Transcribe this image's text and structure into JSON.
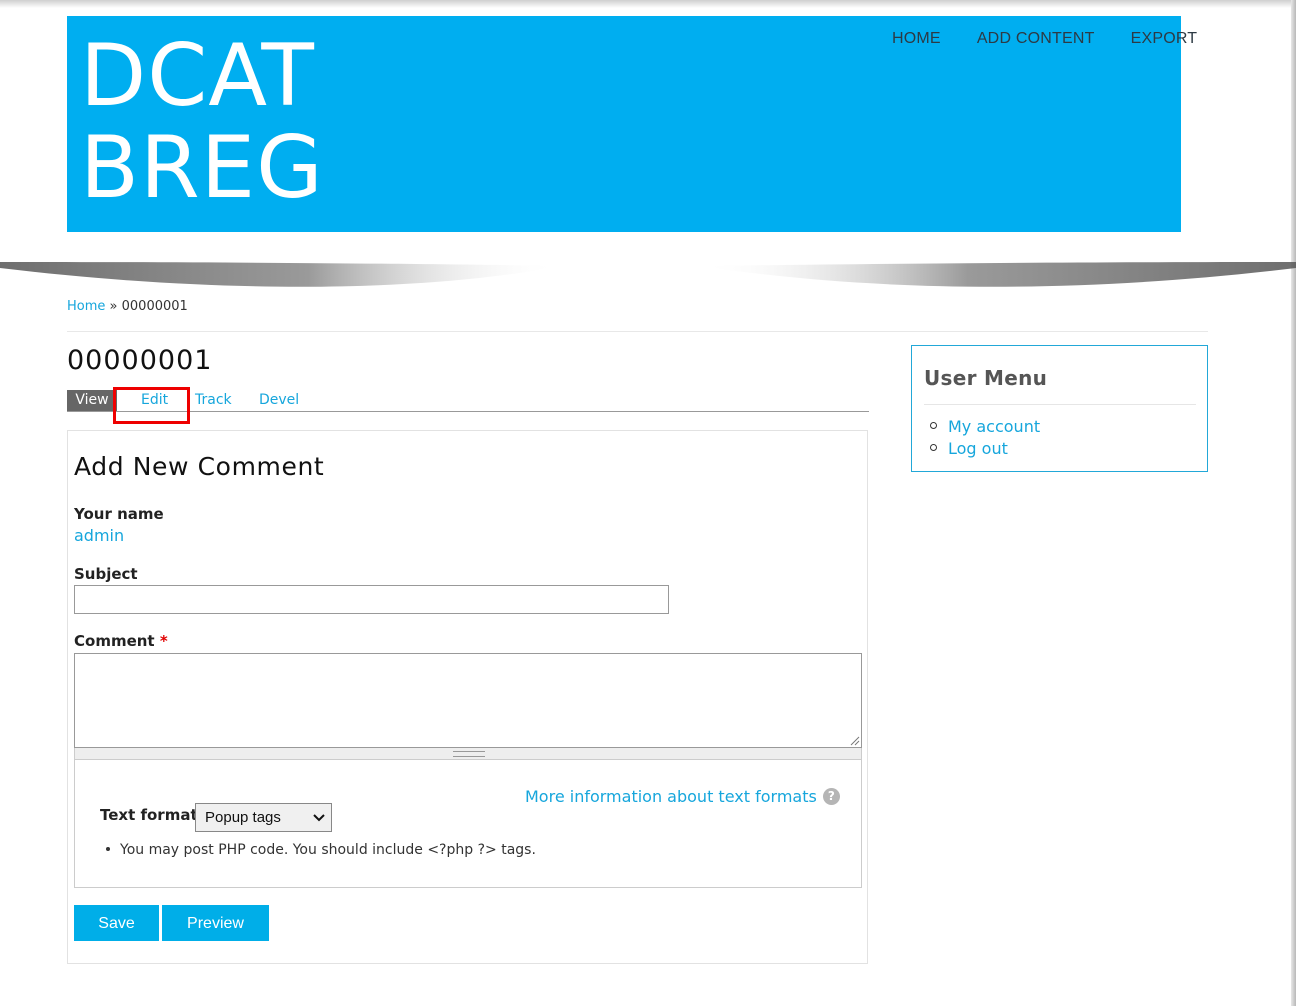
{
  "site": {
    "logo_line1": "DCAT",
    "logo_line2": "BREG",
    "nav": [
      {
        "label": "HOME"
      },
      {
        "label": "ADD CONTENT"
      },
      {
        "label": "EXPORT"
      }
    ]
  },
  "breadcrumb": {
    "home": "Home",
    "separator": "»",
    "current": "00000001"
  },
  "page": {
    "title": "00000001",
    "tabs": [
      {
        "label": "View",
        "active": true
      },
      {
        "label": "Edit",
        "active": false,
        "highlighted": true
      },
      {
        "label": "Track",
        "active": false
      },
      {
        "label": "Devel",
        "active": false
      }
    ]
  },
  "comment_form": {
    "heading": "Add New Comment",
    "name_label": "Your name",
    "name_value": "admin",
    "subject_label": "Subject",
    "subject_value": "",
    "comment_label": "Comment",
    "required_marker": "*",
    "comment_value": "",
    "more_info": "More information about text formats",
    "help_glyph": "?",
    "text_format_label": "Text format",
    "text_format_selected": "Popup tags",
    "tip": "You may post PHP code. You should include <?php ?> tags.",
    "save_label": "Save",
    "preview_label": "Preview"
  },
  "sidebar": {
    "title": "User Menu",
    "items": [
      {
        "label": "My account"
      },
      {
        "label": "Log out"
      }
    ]
  },
  "colors": {
    "brand_blue": "#00aef0",
    "link_blue": "#16a6dc",
    "highlight_red": "#ee0000",
    "button_blue": "#00aee8"
  },
  "icons": {
    "help": "help-icon",
    "select_arrow": "chevron-down-icon",
    "resize": "resize-handle-icon"
  }
}
